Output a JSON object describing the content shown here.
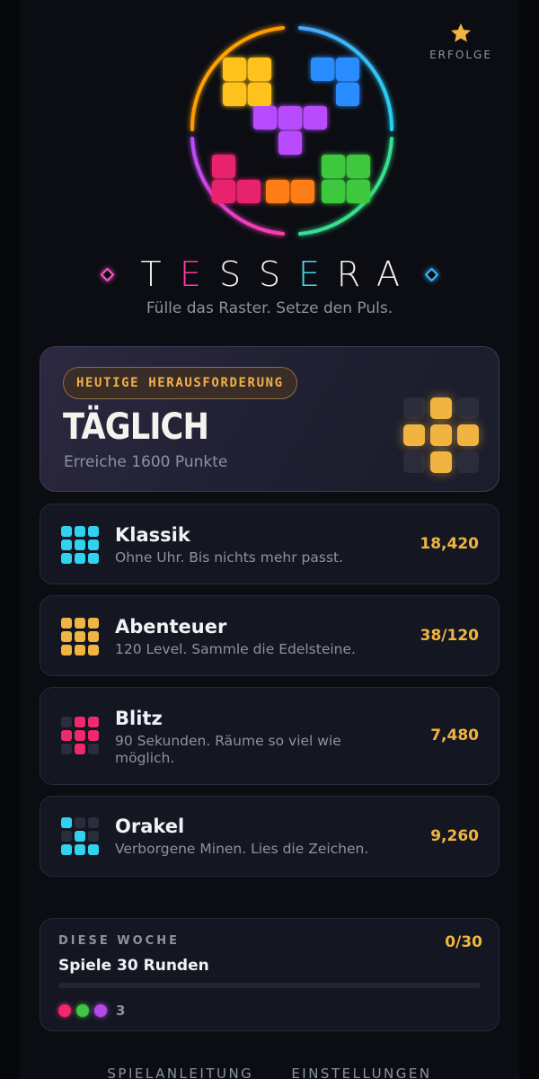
{
  "header": {
    "achievements_label": "ERFOLGE",
    "achievements_icon": "star-icon",
    "accent": "#f2b440"
  },
  "logo": {
    "wordmark": [
      "T",
      "E",
      "S",
      "S",
      "E",
      "R",
      "A"
    ],
    "tagline": "Fülle das Raster. Setze den Puls."
  },
  "daily": {
    "badge": "HEUTIGE HERAUSFORDERUNG",
    "title": "TÄGLICH",
    "subtitle": "Erreiche 1600 Punkte",
    "pattern": [
      0,
      1,
      0,
      1,
      1,
      1,
      0,
      1,
      0
    ]
  },
  "modes": [
    {
      "name": "Klassik",
      "desc": "Ohne Uhr. Bis nichts mehr passt.",
      "score": "18,420",
      "color": "#2fd3f0",
      "pattern": [
        1,
        1,
        1,
        1,
        1,
        1,
        1,
        1,
        1
      ]
    },
    {
      "name": "Abenteuer",
      "desc": "120 Level. Sammle die Edelsteine.",
      "score": "38/120",
      "color": "#f2b440",
      "pattern": [
        1,
        1,
        1,
        1,
        1,
        1,
        1,
        1,
        1
      ]
    },
    {
      "name": "Blitz",
      "desc": "90 Sekunden. Räume so viel wie möglich.",
      "score": "7,480",
      "color": "#f0286e",
      "pattern": [
        0,
        1,
        1,
        1,
        1,
        1,
        0,
        1,
        0
      ]
    },
    {
      "name": "Orakel",
      "desc": "Verborgene Minen. Lies die Zeichen.",
      "score": "9,260",
      "color": "#2fd3f0",
      "pattern": [
        1,
        0,
        0,
        0,
        1,
        0,
        1,
        1,
        1
      ]
    }
  ],
  "weekly": {
    "label": "DIESE WOCHE",
    "count": "0/30",
    "title": "Spiele 30 Runden",
    "progress": 0,
    "dots": [
      "#f0286e",
      "#43c447",
      "#b54ae8"
    ],
    "dots_count": "3"
  },
  "footer": {
    "howto": "SPIELANLEITUNG",
    "settings": "EINSTELLUNGEN"
  }
}
